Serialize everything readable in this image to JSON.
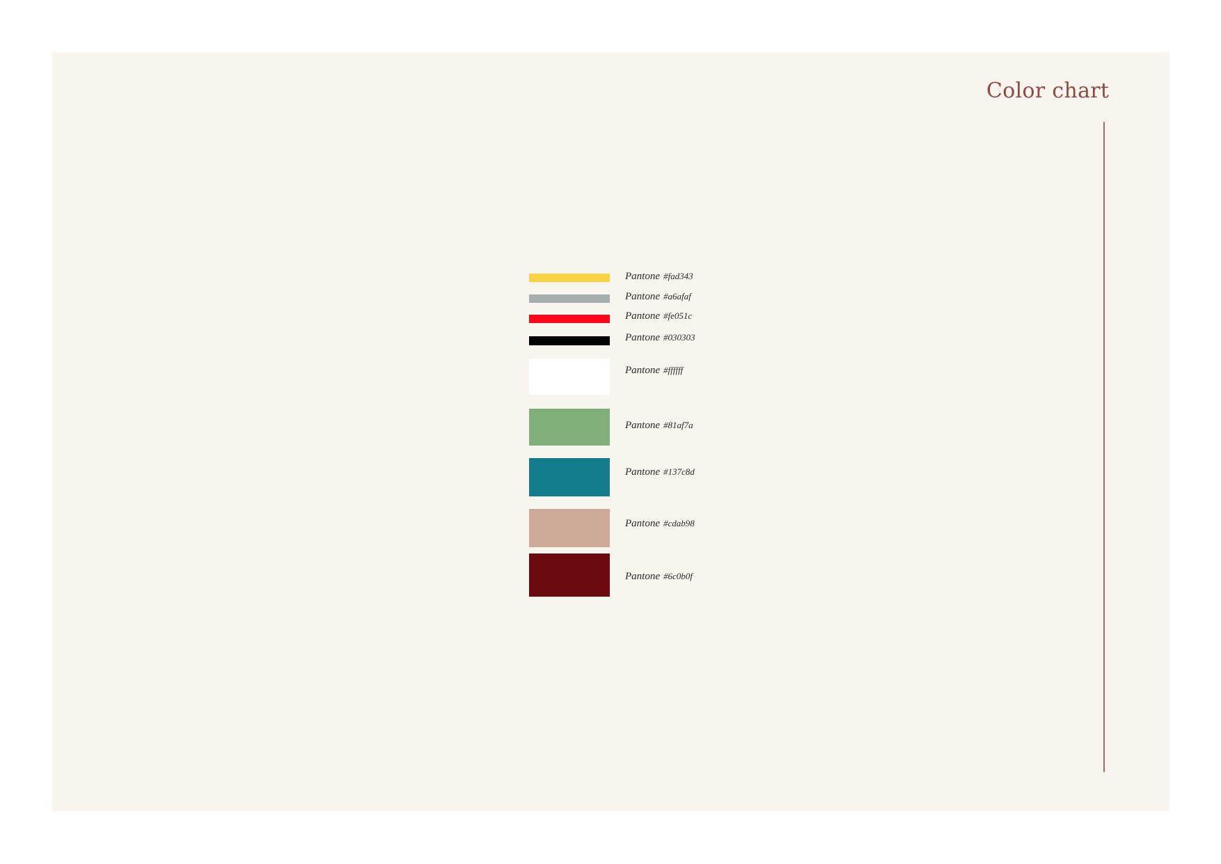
{
  "title": "Color chart",
  "swatches": [
    {
      "prefix": "Pantone",
      "code": "#fad343",
      "color": "#fad343"
    },
    {
      "prefix": "Pantone",
      "code": "#a6afaf",
      "color": "#a6afaf"
    },
    {
      "prefix": "Pantone",
      "code": "#fe051c",
      "color": "#fe051c"
    },
    {
      "prefix": "Pantone",
      "code": "#030303",
      "color": "#030303"
    },
    {
      "prefix": "Pantone",
      "code": "#ffffff",
      "color": "#ffffff"
    },
    {
      "prefix": "Pantone",
      "code": "#81af7a",
      "color": "#81af7a"
    },
    {
      "prefix": "Pantone",
      "code": "#137c8d",
      "color": "#137c8d"
    },
    {
      "prefix": "Pantone",
      "code": "#cdab98",
      "color": "#cdab98"
    },
    {
      "prefix": "Pantone",
      "code": "#6c0b0f",
      "color": "#6c0b0f"
    }
  ]
}
